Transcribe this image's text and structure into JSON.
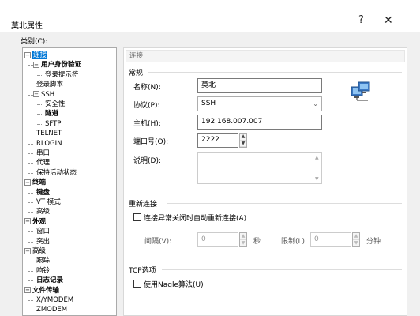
{
  "window": {
    "title": "莫北属性",
    "help": "?",
    "close": "✕"
  },
  "category_label": "类别(C):",
  "tree": [
    {
      "label": "连接",
      "indent": 0,
      "expander": "⊟",
      "selected": true,
      "bold": false
    },
    {
      "label": "用户身份验证",
      "indent": 1,
      "expander": "⊟",
      "selected": false,
      "bold": true
    },
    {
      "label": "登录提示符",
      "indent": 2,
      "expander": "",
      "selected": false,
      "bold": false
    },
    {
      "label": "登录脚本",
      "indent": 1,
      "expander": "",
      "selected": false,
      "bold": false
    },
    {
      "label": "SSH",
      "indent": 1,
      "expander": "⊟",
      "selected": false,
      "bold": false
    },
    {
      "label": "安全性",
      "indent": 2,
      "expander": "",
      "selected": false,
      "bold": false
    },
    {
      "label": "隧道",
      "indent": 2,
      "expander": "",
      "selected": false,
      "bold": true
    },
    {
      "label": "SFTP",
      "indent": 2,
      "expander": "",
      "selected": false,
      "bold": false
    },
    {
      "label": "TELNET",
      "indent": 1,
      "expander": "",
      "selected": false,
      "bold": false
    },
    {
      "label": "RLOGIN",
      "indent": 1,
      "expander": "",
      "selected": false,
      "bold": false
    },
    {
      "label": "串口",
      "indent": 1,
      "expander": "",
      "selected": false,
      "bold": false
    },
    {
      "label": "代理",
      "indent": 1,
      "expander": "",
      "selected": false,
      "bold": false
    },
    {
      "label": "保持活动状态",
      "indent": 1,
      "expander": "",
      "selected": false,
      "bold": false
    },
    {
      "label": "终端",
      "indent": 0,
      "expander": "⊟",
      "selected": false,
      "bold": true
    },
    {
      "label": "键盘",
      "indent": 1,
      "expander": "",
      "selected": false,
      "bold": true
    },
    {
      "label": "VT 模式",
      "indent": 1,
      "expander": "",
      "selected": false,
      "bold": false
    },
    {
      "label": "高级",
      "indent": 1,
      "expander": "",
      "selected": false,
      "bold": false
    },
    {
      "label": "外观",
      "indent": 0,
      "expander": "⊟",
      "selected": false,
      "bold": true
    },
    {
      "label": "窗口",
      "indent": 1,
      "expander": "",
      "selected": false,
      "bold": false
    },
    {
      "label": "突出",
      "indent": 1,
      "expander": "",
      "selected": false,
      "bold": false
    },
    {
      "label": "高级",
      "indent": 0,
      "expander": "⊟",
      "selected": false,
      "bold": false
    },
    {
      "label": "跟踪",
      "indent": 1,
      "expander": "",
      "selected": false,
      "bold": false
    },
    {
      "label": "响铃",
      "indent": 1,
      "expander": "",
      "selected": false,
      "bold": false
    },
    {
      "label": "日志记录",
      "indent": 1,
      "expander": "",
      "selected": false,
      "bold": true
    },
    {
      "label": "文件传输",
      "indent": 0,
      "expander": "⊟",
      "selected": false,
      "bold": true
    },
    {
      "label": "X/YMODEM",
      "indent": 1,
      "expander": "",
      "selected": false,
      "bold": false
    },
    {
      "label": "ZMODEM",
      "indent": 1,
      "expander": "",
      "selected": false,
      "bold": false
    }
  ],
  "panel": {
    "header": "连接",
    "general": {
      "title": "常规",
      "name_label": "名称(N):",
      "name_value": "莫北",
      "protocol_label": "协议(P):",
      "protocol_value": "SSH",
      "host_label": "主机(H):",
      "host_value": "192.168.007.007",
      "port_label": "端口号(O):",
      "port_value": "2222",
      "desc_label": "说明(D):",
      "desc_value": ""
    },
    "reconnect": {
      "title": "重新连接",
      "auto_label": "连接异常关闭时自动重新连接(A)",
      "auto_checked": false,
      "interval_label": "间隔(V):",
      "interval_value": "0",
      "interval_unit": "秒",
      "limit_label": "限制(L):",
      "limit_value": "0",
      "limit_unit": "分钟"
    },
    "tcp": {
      "title": "TCP选项",
      "nagle_label": "使用Nagle算法(U)",
      "nagle_checked": false
    }
  },
  "icons": {
    "connection": "network-computer-icon"
  },
  "colors": {
    "selection": "#0078d7"
  }
}
